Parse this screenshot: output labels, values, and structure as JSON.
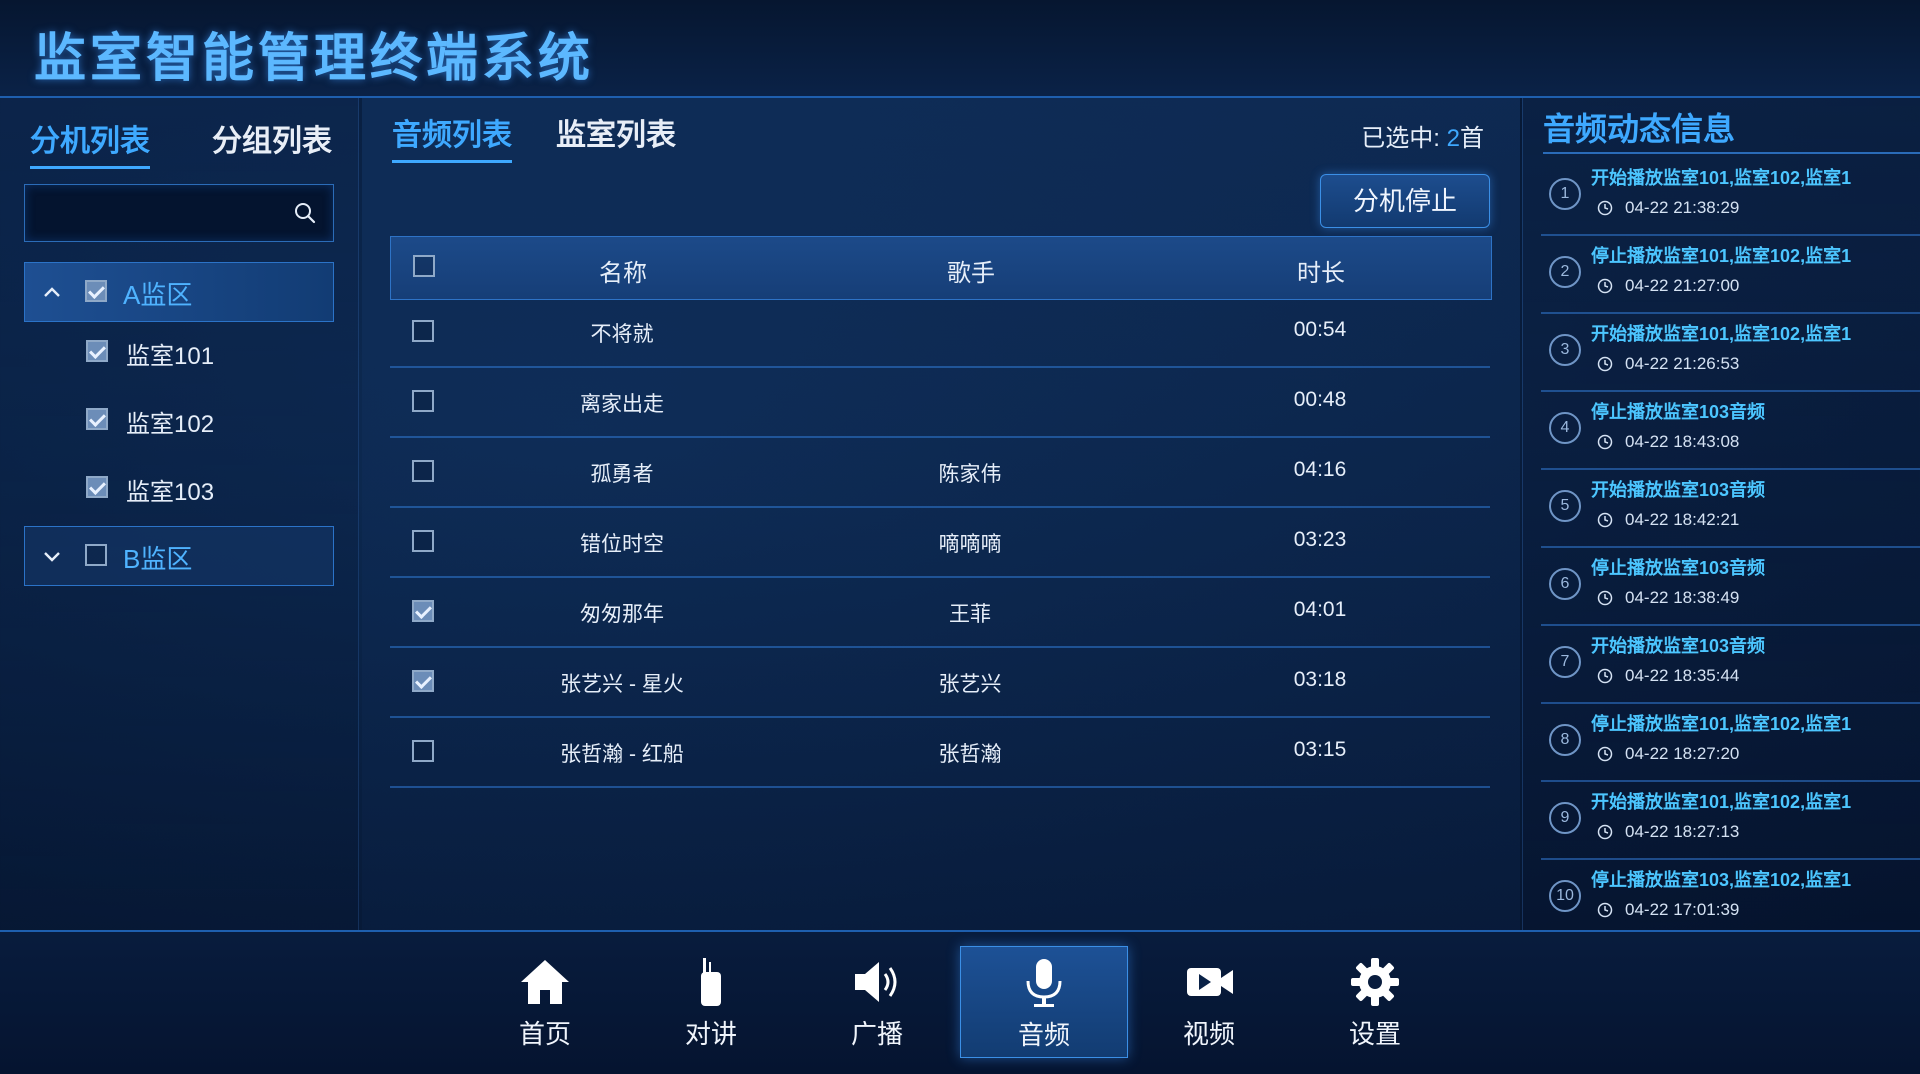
{
  "app": {
    "title": "监室智能管理终端系统"
  },
  "left": {
    "tabs": [
      {
        "label": "分机列表",
        "active": true
      },
      {
        "label": "分组列表",
        "active": false
      }
    ],
    "search": {
      "placeholder": ""
    },
    "groups": [
      {
        "label": "A监区",
        "expanded": true,
        "checked": true,
        "rooms": [
          {
            "label": "监室101",
            "checked": true
          },
          {
            "label": "监室102",
            "checked": true
          },
          {
            "label": "监室103",
            "checked": true
          }
        ]
      },
      {
        "label": "B监区",
        "expanded": false,
        "checked": false
      }
    ]
  },
  "center": {
    "tabs": [
      {
        "label": "音频列表",
        "active": true
      },
      {
        "label": "监室列表",
        "active": false
      }
    ],
    "selected": {
      "prefix": "已选中:",
      "count": "2",
      "suffix": "首"
    },
    "stop_button": "分机停止",
    "table": {
      "headers": [
        "名称",
        "歌手",
        "时长"
      ],
      "rows": [
        {
          "name": "不将就",
          "singer": "",
          "duration": "00:54",
          "checked": false
        },
        {
          "name": "离家出走",
          "singer": "",
          "duration": "00:48",
          "checked": false
        },
        {
          "name": "孤勇者",
          "singer": "陈家伟",
          "duration": "04:16",
          "checked": false
        },
        {
          "name": "错位时空",
          "singer": "嘀嘀嘀",
          "duration": "03:23",
          "checked": false
        },
        {
          "name": "匆匆那年",
          "singer": "王菲",
          "duration": "04:01",
          "checked": true
        },
        {
          "name": "张艺兴 - 星火",
          "singer": "张艺兴",
          "duration": "03:18",
          "checked": true
        },
        {
          "name": "张哲瀚 - 红船",
          "singer": "张哲瀚",
          "duration": "03:15",
          "checked": false
        }
      ]
    }
  },
  "right": {
    "title": "音频动态信息",
    "logs": [
      {
        "num": "1",
        "text": "开始播放监室101,监室102,监室1",
        "time": "04-22 21:38:29"
      },
      {
        "num": "2",
        "text": "停止播放监室101,监室102,监室1",
        "time": "04-22 21:27:00"
      },
      {
        "num": "3",
        "text": "开始播放监室101,监室102,监室1",
        "time": "04-22 21:26:53"
      },
      {
        "num": "4",
        "text": "停止播放监室103音频",
        "time": "04-22 18:43:08"
      },
      {
        "num": "5",
        "text": "开始播放监室103音频",
        "time": "04-22 18:42:21"
      },
      {
        "num": "6",
        "text": "停止播放监室103音频",
        "time": "04-22 18:38:49"
      },
      {
        "num": "7",
        "text": "开始播放监室103音频",
        "time": "04-22 18:35:44"
      },
      {
        "num": "8",
        "text": "停止播放监室101,监室102,监室1",
        "time": "04-22 18:27:20"
      },
      {
        "num": "9",
        "text": "开始播放监室101,监室102,监室1",
        "time": "04-22 18:27:13"
      },
      {
        "num": "10",
        "text": "停止播放监室103,监室102,监室1",
        "time": "04-22 17:01:39"
      }
    ]
  },
  "nav": [
    {
      "label": "首页",
      "icon": "home-icon",
      "active": false
    },
    {
      "label": "对讲",
      "icon": "walkie-talkie-icon",
      "active": false
    },
    {
      "label": "广播",
      "icon": "speaker-icon",
      "active": false
    },
    {
      "label": "音频",
      "icon": "microphone-icon",
      "active": true
    },
    {
      "label": "视频",
      "icon": "video-camera-icon",
      "active": false
    },
    {
      "label": "设置",
      "icon": "gear-icon",
      "active": false
    }
  ],
  "colors": {
    "accent": "#3ea9ff",
    "log_text": "#4cc6ff",
    "background": "#071a38"
  }
}
